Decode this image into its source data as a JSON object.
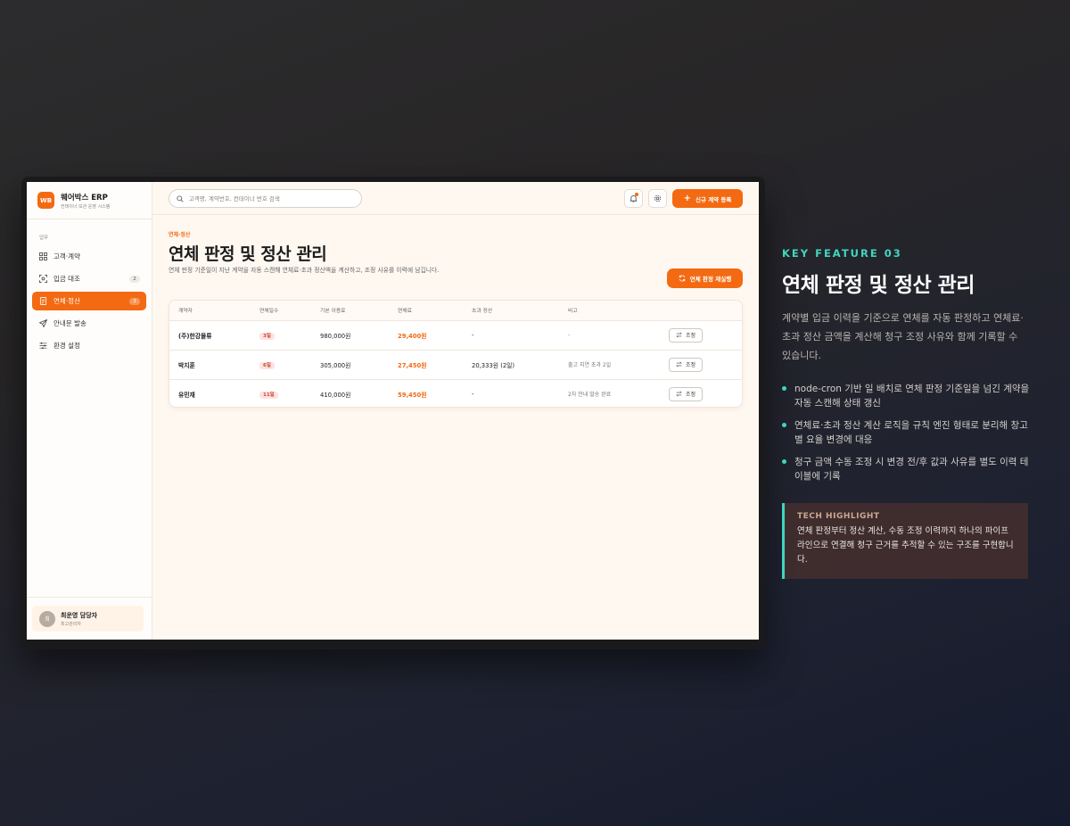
{
  "app": {
    "logo_text": "WB",
    "name": "웨어박스 ERP",
    "subtitle": "컨테이너 보관 운영 시스템"
  },
  "sidebar": {
    "section_label": "업무",
    "items": [
      {
        "label": "고객·계약",
        "icon": "grid-icon",
        "badge": ""
      },
      {
        "label": "입금 대조",
        "icon": "scan-icon",
        "badge": "2"
      },
      {
        "label": "연체·정산",
        "icon": "document-icon",
        "badge": "3",
        "active": true
      },
      {
        "label": "안내문 발송",
        "icon": "send-icon",
        "badge": ""
      },
      {
        "label": "환경 설정",
        "icon": "sliders-icon",
        "badge": ""
      }
    ],
    "user": {
      "avatar": "최",
      "name": "최운영 담당자",
      "role": "최고관리자"
    }
  },
  "topbar": {
    "search_placeholder": "고객명, 계약번호, 컨테이너 번호 검색",
    "new_contract_label": "신규 계약 등록"
  },
  "page": {
    "breadcrumb": "연체·정산",
    "title": "연체 판정 및 정산 관리",
    "description": "연체 판정 기준일이 지난 계약을 자동 스캔해 연체료·초과 정산액을 계산하고, 조정 사유를 이력에 남깁니다.",
    "rerun_label": "연체 판정 재실행"
  },
  "table": {
    "headers": [
      "계약자",
      "연체일수",
      "기본 이용료",
      "연체료",
      "초과 정산",
      "비고",
      ""
    ],
    "adjust_label": "조정",
    "rows": [
      {
        "name": "(주)한강물류",
        "days": "3일",
        "base_fee": "980,000원",
        "late_fee": "29,400원",
        "excess": "-",
        "note": "-"
      },
      {
        "name": "박지훈",
        "days": "6일",
        "base_fee": "305,000원",
        "late_fee": "27,450원",
        "excess": "20,333원 (2일)",
        "note": "출고 지연 초과 2일"
      },
      {
        "name": "유민재",
        "days": "11일",
        "base_fee": "410,000원",
        "late_fee": "59,450원",
        "excess": "-",
        "note": "2차 안내 발송 완료"
      }
    ]
  },
  "feature": {
    "tag": "KEY FEATURE 03",
    "title": "연체 판정 및 정산 관리",
    "description": "계약별 입금 이력을 기준으로 연체를 자동 판정하고 연체료·초과 정산 금액을 계산해 청구 조정 사유와 함께 기록할 수 있습니다.",
    "bullets": [
      "node-cron 기반 일 배치로 연체 판정 기준일을 넘긴 계약을 자동 스캔해 상태 갱신",
      "연체료·초과 정산 계산 로직을 규칙 엔진 형태로 분리해 창고별 요율 변경에 대응",
      "청구 금액 수동 조정 시 변경 전/후 값과 사유를 별도 이력 테이블에 기록"
    ],
    "highlight_title": "TECH HIGHLIGHT",
    "highlight_text": "연체 판정부터 정산 계산, 수동 조정 이력까지 하나의 파이프라인으로 연결해 청구 근거를 추적할 수 있는 구조를 구현합니다."
  },
  "colors": {
    "accent": "#f36a12",
    "teal": "#3fd6c1"
  }
}
